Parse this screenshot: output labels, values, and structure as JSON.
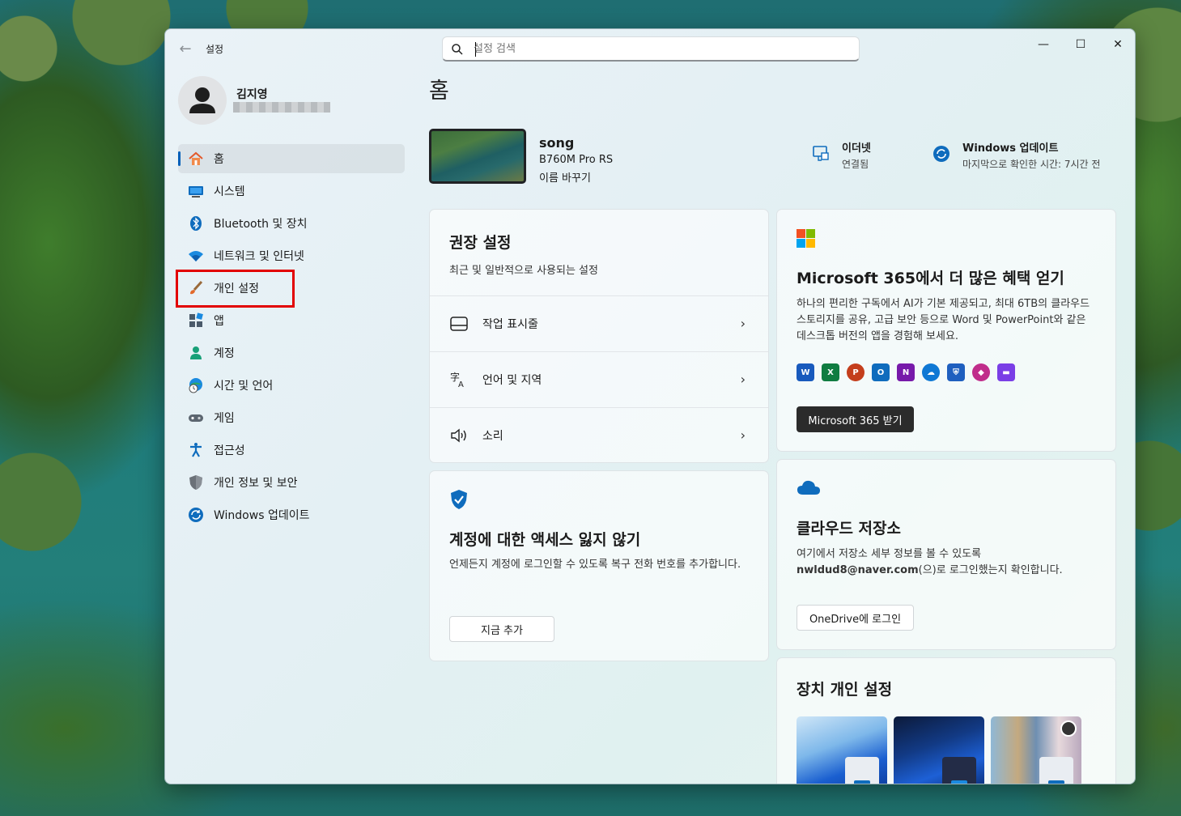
{
  "window": {
    "title": "설정",
    "back_label": "←",
    "min": "—",
    "max": "☐",
    "close": "✕"
  },
  "search": {
    "placeholder": "설정 검색",
    "value": ""
  },
  "user": {
    "name": "김지영"
  },
  "nav": [
    {
      "label": "홈",
      "icon": "home-icon",
      "active": true
    },
    {
      "label": "시스템",
      "icon": "system-icon"
    },
    {
      "label": "Bluetooth 및 장치",
      "icon": "bluetooth-icon"
    },
    {
      "label": "네트워크 및 인터넷",
      "icon": "wifi-icon"
    },
    {
      "label": "개인 설정",
      "icon": "brush-icon",
      "highlighted": true
    },
    {
      "label": "앱",
      "icon": "apps-icon"
    },
    {
      "label": "계정",
      "icon": "account-icon"
    },
    {
      "label": "시간 및 언어",
      "icon": "globe-clock-icon"
    },
    {
      "label": "게임",
      "icon": "gamepad-icon"
    },
    {
      "label": "접근성",
      "icon": "accessibility-icon"
    },
    {
      "label": "개인 정보 및 보안",
      "icon": "shield-icon"
    },
    {
      "label": "Windows 업데이트",
      "icon": "update-icon"
    }
  ],
  "page": {
    "title": "홈"
  },
  "pc": {
    "name": "song",
    "model": "B760M Pro RS",
    "rename": "이름 바꾸기"
  },
  "status": {
    "ethernet": {
      "title": "이더넷",
      "value": "연결됨"
    },
    "update": {
      "title": "Windows 업데이트",
      "value": "마지막으로 확인한 시간: 7시간 전"
    }
  },
  "recommended": {
    "title": "권장 설정",
    "subtitle": "최근 및 일반적으로 사용되는 설정",
    "items": [
      {
        "label": "작업 표시줄",
        "icon": "taskbar-icon"
      },
      {
        "label": "언어 및 지역",
        "icon": "language-icon"
      },
      {
        "label": "소리",
        "icon": "speaker-icon"
      }
    ]
  },
  "account_card": {
    "title": "계정에 대한 액세스 잃지 않기",
    "body": "언제든지 계정에 로그인할 수 있도록 복구 전화 번호를 추가합니다.",
    "button": "지금 추가"
  },
  "m365": {
    "title": "Microsoft 365에서 더 많은 혜택 얻기",
    "body": "하나의 편리한 구독에서 AI가 기본 제공되고, 최대 6TB의 클라우드 스토리지를 공유, 고급 보안 등으로 Word 및 PowerPoint와 같은 데스크톱 버전의 앱을 경험해 보세요.",
    "button": "Microsoft 365 받기",
    "apps": [
      "W",
      "X",
      "P",
      "O",
      "N",
      "☁",
      "⛨",
      "◆",
      "▬"
    ],
    "app_colors": [
      "#185abd",
      "#107c41",
      "#c43e1c",
      "#0f6cbd",
      "#7719aa",
      "#0f78d4",
      "#1f5fbf",
      "#c02d8b",
      "#7a3ee6"
    ]
  },
  "cloud": {
    "title": "클라우드 저장소",
    "body_line1": "여기에서 저장소 세부 정보를 볼 수 있도록",
    "email": "nwldud8@naver.com",
    "body_line2_rest": "(으)로 로그인했는지 확인합니다.",
    "button": "OneDrive에 로그인"
  },
  "device_personal": {
    "title": "장치 개인 설정"
  },
  "colors": {
    "accent": "#005fb8",
    "highlight_box": "#e20000"
  }
}
